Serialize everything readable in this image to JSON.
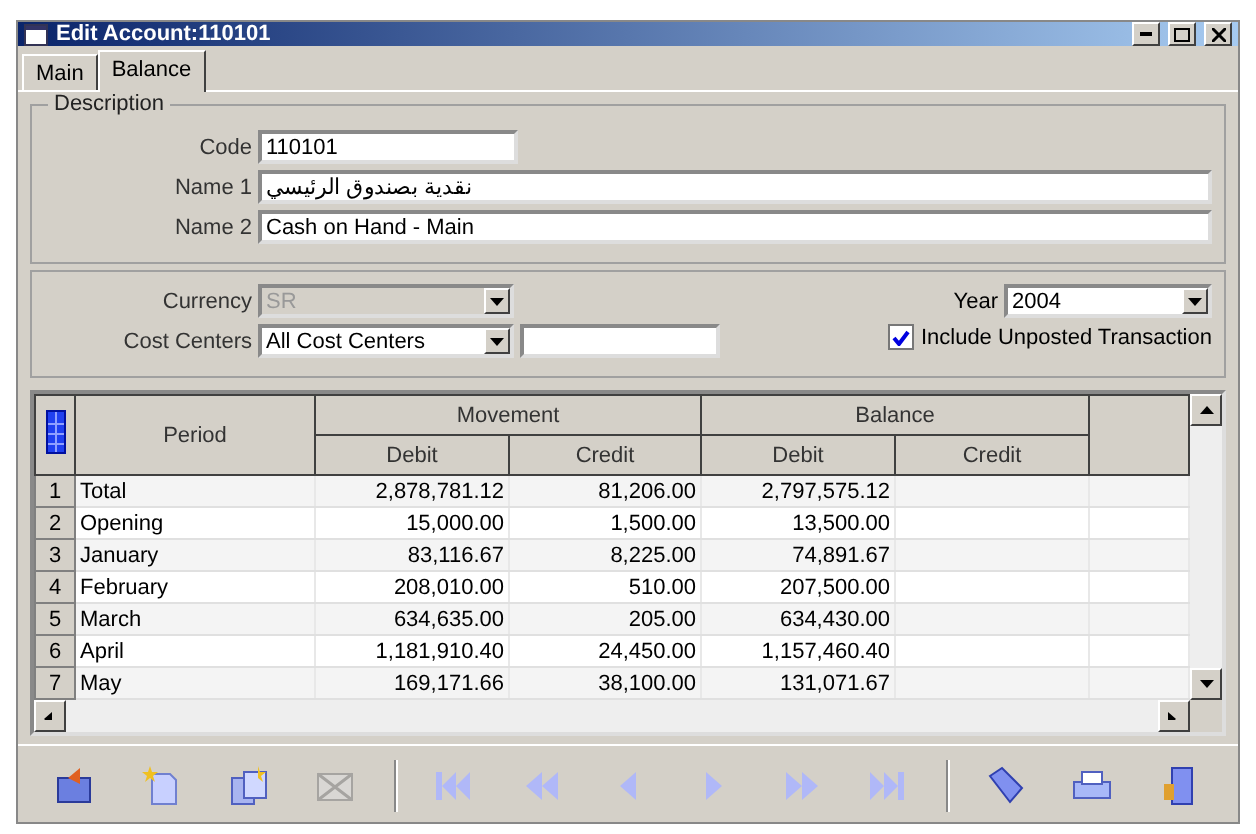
{
  "window": {
    "title": "Edit Account:110101"
  },
  "tabs": [
    {
      "label": "Main",
      "selected": false
    },
    {
      "label": "Balance",
      "selected": true
    }
  ],
  "description": {
    "legend": "Description",
    "fields": [
      {
        "label": "Code",
        "value": "110101",
        "kind": "short"
      },
      {
        "label": "Name 1",
        "value": "نقدية بصندوق الرئيسي",
        "kind": "rtl"
      },
      {
        "label": "Name 2",
        "value": "Cash on Hand - Main",
        "kind": "wide"
      }
    ]
  },
  "filters": {
    "currency": {
      "label": "Currency",
      "value": "SR",
      "disabled": true
    },
    "cost_centers": {
      "label": "Cost Centers",
      "value": "All Cost Centers",
      "disabled": false
    },
    "year": {
      "label": "Year",
      "value": "2004"
    },
    "include_unposted": {
      "label": "Include Unposted Transaction",
      "checked": true
    }
  },
  "grid": {
    "period_header": "Period",
    "groups": [
      {
        "label": "Movement",
        "columns": [
          "Debit",
          "Credit"
        ]
      },
      {
        "label": "Balance",
        "columns": [
          "Debit",
          "Credit"
        ]
      }
    ],
    "rows": [
      {
        "number": "1",
        "period": "Total",
        "values": [
          "2,878,781.12",
          "81,206.00",
          "2,797,575.12"
        ]
      },
      {
        "number": "2",
        "period": "Opening",
        "values": [
          "15,000.00",
          "1,500.00",
          "13,500.00"
        ]
      },
      {
        "number": "3",
        "period": "January",
        "values": [
          "83,116.67",
          "8,225.00",
          "74,891.67"
        ]
      },
      {
        "number": "4",
        "period": "February",
        "values": [
          "208,010.00",
          "510.00",
          "207,500.00"
        ]
      },
      {
        "number": "5",
        "period": "March",
        "values": [
          "634,635.00",
          "205.00",
          "634,430.00"
        ]
      },
      {
        "number": "6",
        "period": "April",
        "values": [
          "1,181,910.40",
          "24,450.00",
          "1,157,460.40"
        ]
      },
      {
        "number": "7",
        "period": "May",
        "values": [
          "169,171.66",
          "38,100.00",
          "131,071.67"
        ]
      }
    ]
  },
  "toolbar": [
    {
      "kind": "save",
      "disabled": false
    },
    {
      "kind": "new",
      "disabled": false
    },
    {
      "kind": "copy",
      "disabled": false
    },
    {
      "kind": "delete",
      "disabled": true
    },
    {
      "kind": "first",
      "disabled": false
    },
    {
      "kind": "rewind",
      "disabled": false
    },
    {
      "kind": "prev",
      "disabled": false
    },
    {
      "kind": "next",
      "disabled": false
    },
    {
      "kind": "forward",
      "disabled": false
    },
    {
      "kind": "last",
      "disabled": false
    },
    {
      "kind": "search",
      "disabled": false
    },
    {
      "kind": "print",
      "disabled": false
    },
    {
      "kind": "exit",
      "disabled": false
    }
  ]
}
